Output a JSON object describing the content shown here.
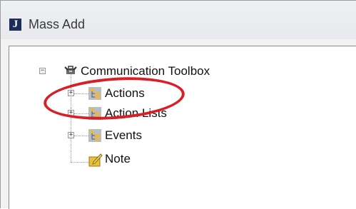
{
  "window": {
    "title": "Mass Add",
    "app_icon_letter": "J"
  },
  "tree": {
    "root": {
      "label": "Communication Toolbox",
      "expander": "−",
      "icon": "toolbox-icon"
    },
    "items": [
      {
        "label": "Actions",
        "expander": "+",
        "icon": "folder-tree-icon"
      },
      {
        "label": "Action Lists",
        "expander": "+",
        "icon": "folder-tree-icon"
      },
      {
        "label": "Events",
        "expander": "+",
        "icon": "folder-tree-icon"
      },
      {
        "label": "Note",
        "icon": "note-icon"
      }
    ]
  },
  "annotation": {
    "color": "#d81f26",
    "shape": "ellipse-around-actions"
  }
}
